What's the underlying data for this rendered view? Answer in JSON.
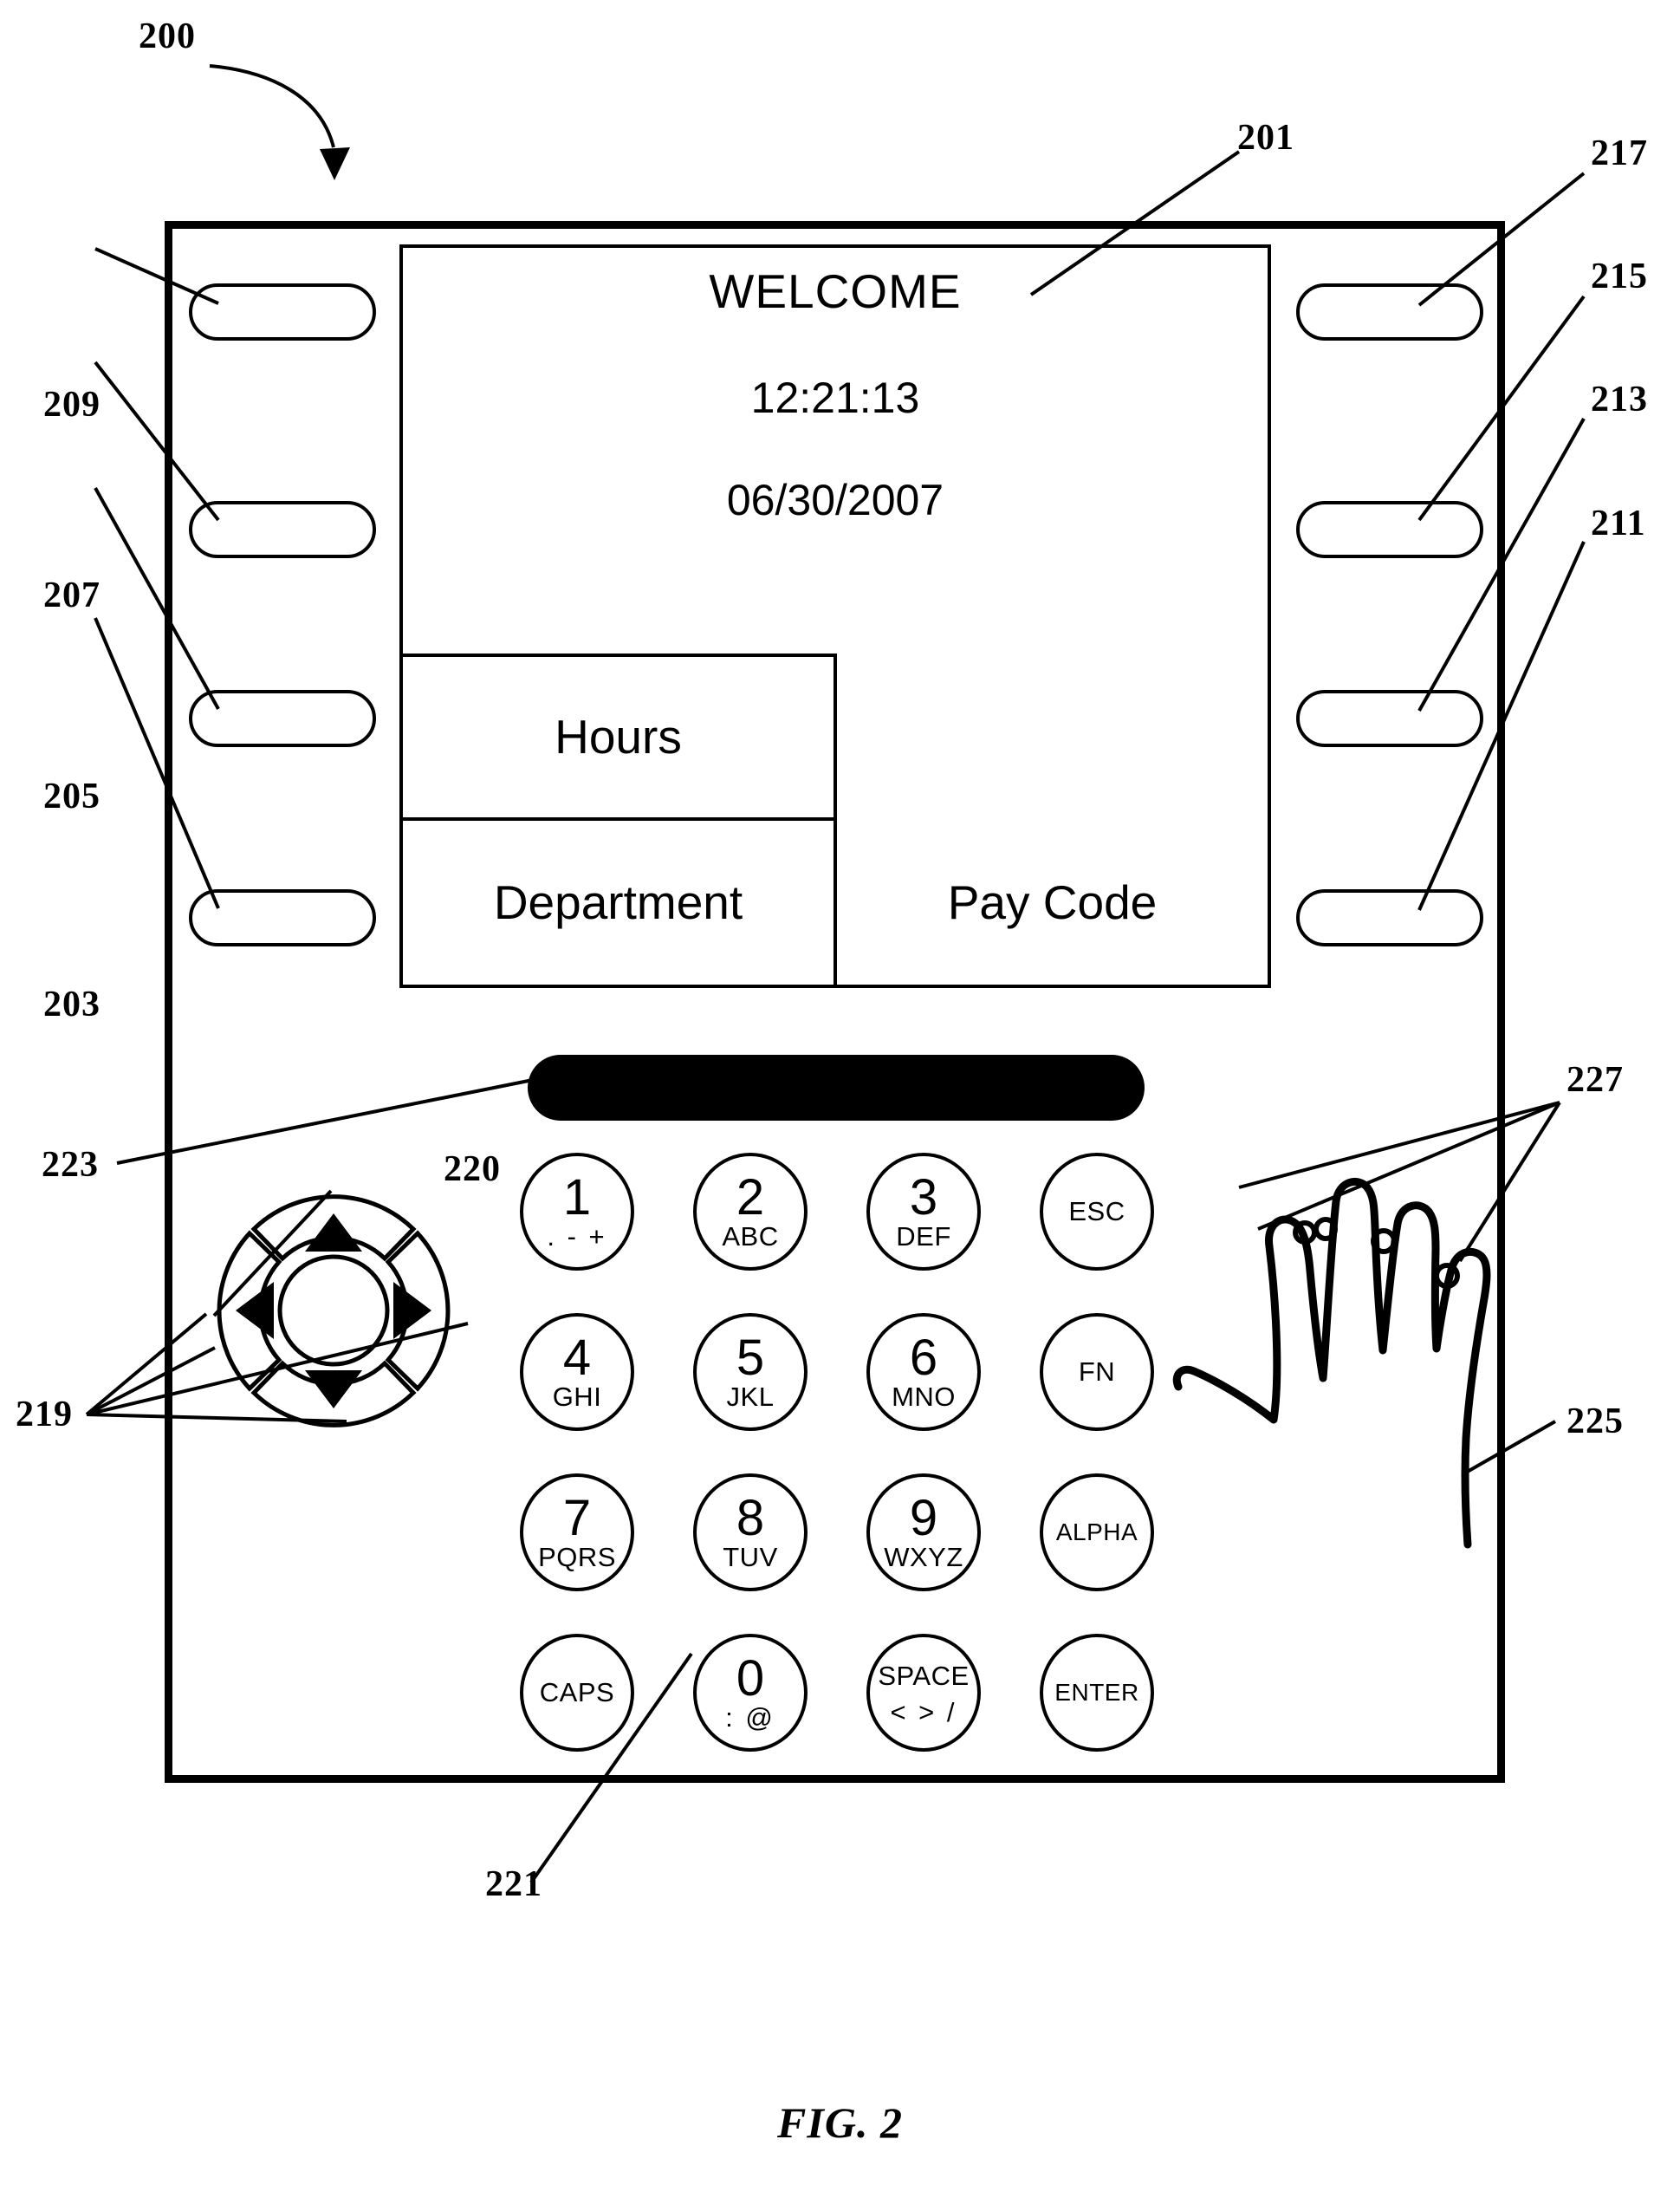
{
  "figure": {
    "caption": "FIG. 2",
    "device_ref": "200"
  },
  "display": {
    "ref": "201",
    "welcome": "WELCOME",
    "time": "12:21:13",
    "date": "06/30/2007",
    "tiles": [
      {
        "label": "Hours"
      },
      {
        "label": "Department"
      },
      {
        "label": "Pay Code"
      }
    ]
  },
  "softkeys": {
    "left": [
      {
        "ref": "209"
      },
      {
        "ref": "207"
      },
      {
        "ref": "205"
      },
      {
        "ref": "203"
      }
    ],
    "right": [
      {
        "ref": "217"
      },
      {
        "ref": "215"
      },
      {
        "ref": "213"
      },
      {
        "ref": "211"
      }
    ]
  },
  "badge_reader": {
    "ref": "223"
  },
  "navpad": {
    "arrows_ref": "219",
    "center_ref": "220",
    "up_icon": "arrow-up-icon",
    "down_icon": "arrow-down-icon",
    "left_icon": "arrow-left-icon",
    "right_icon": "arrow-right-icon"
  },
  "keypad": {
    "ref": "221",
    "keys": [
      {
        "digit": "1",
        "letters": ". - +",
        "spaced": true
      },
      {
        "digit": "2",
        "letters": "ABC",
        "spaced": false
      },
      {
        "digit": "3",
        "letters": "DEF",
        "spaced": false
      },
      {
        "digit": "",
        "letters": "",
        "fn": "ESC"
      },
      {
        "digit": "4",
        "letters": "GHI",
        "spaced": false
      },
      {
        "digit": "5",
        "letters": "JKL",
        "spaced": false
      },
      {
        "digit": "6",
        "letters": "MNO",
        "spaced": false
      },
      {
        "digit": "",
        "letters": "",
        "fn": "FN"
      },
      {
        "digit": "7",
        "letters": "PQRS",
        "spaced": false
      },
      {
        "digit": "8",
        "letters": "TUV",
        "spaced": false
      },
      {
        "digit": "9",
        "letters": "WXYZ",
        "spaced": false
      },
      {
        "digit": "",
        "letters": "",
        "fn": "ALPHA"
      },
      {
        "digit": "",
        "letters": "",
        "fn": "CAPS"
      },
      {
        "digit": "0",
        "letters": ": @",
        "spaced": true
      },
      {
        "digit": "",
        "letters": "< > /",
        "fn": "SPACE",
        "spaced": true
      },
      {
        "digit": "",
        "letters": "",
        "fn": "ENTER"
      }
    ]
  },
  "biometric": {
    "hand_ref": "225",
    "sensor_ref": "227"
  }
}
